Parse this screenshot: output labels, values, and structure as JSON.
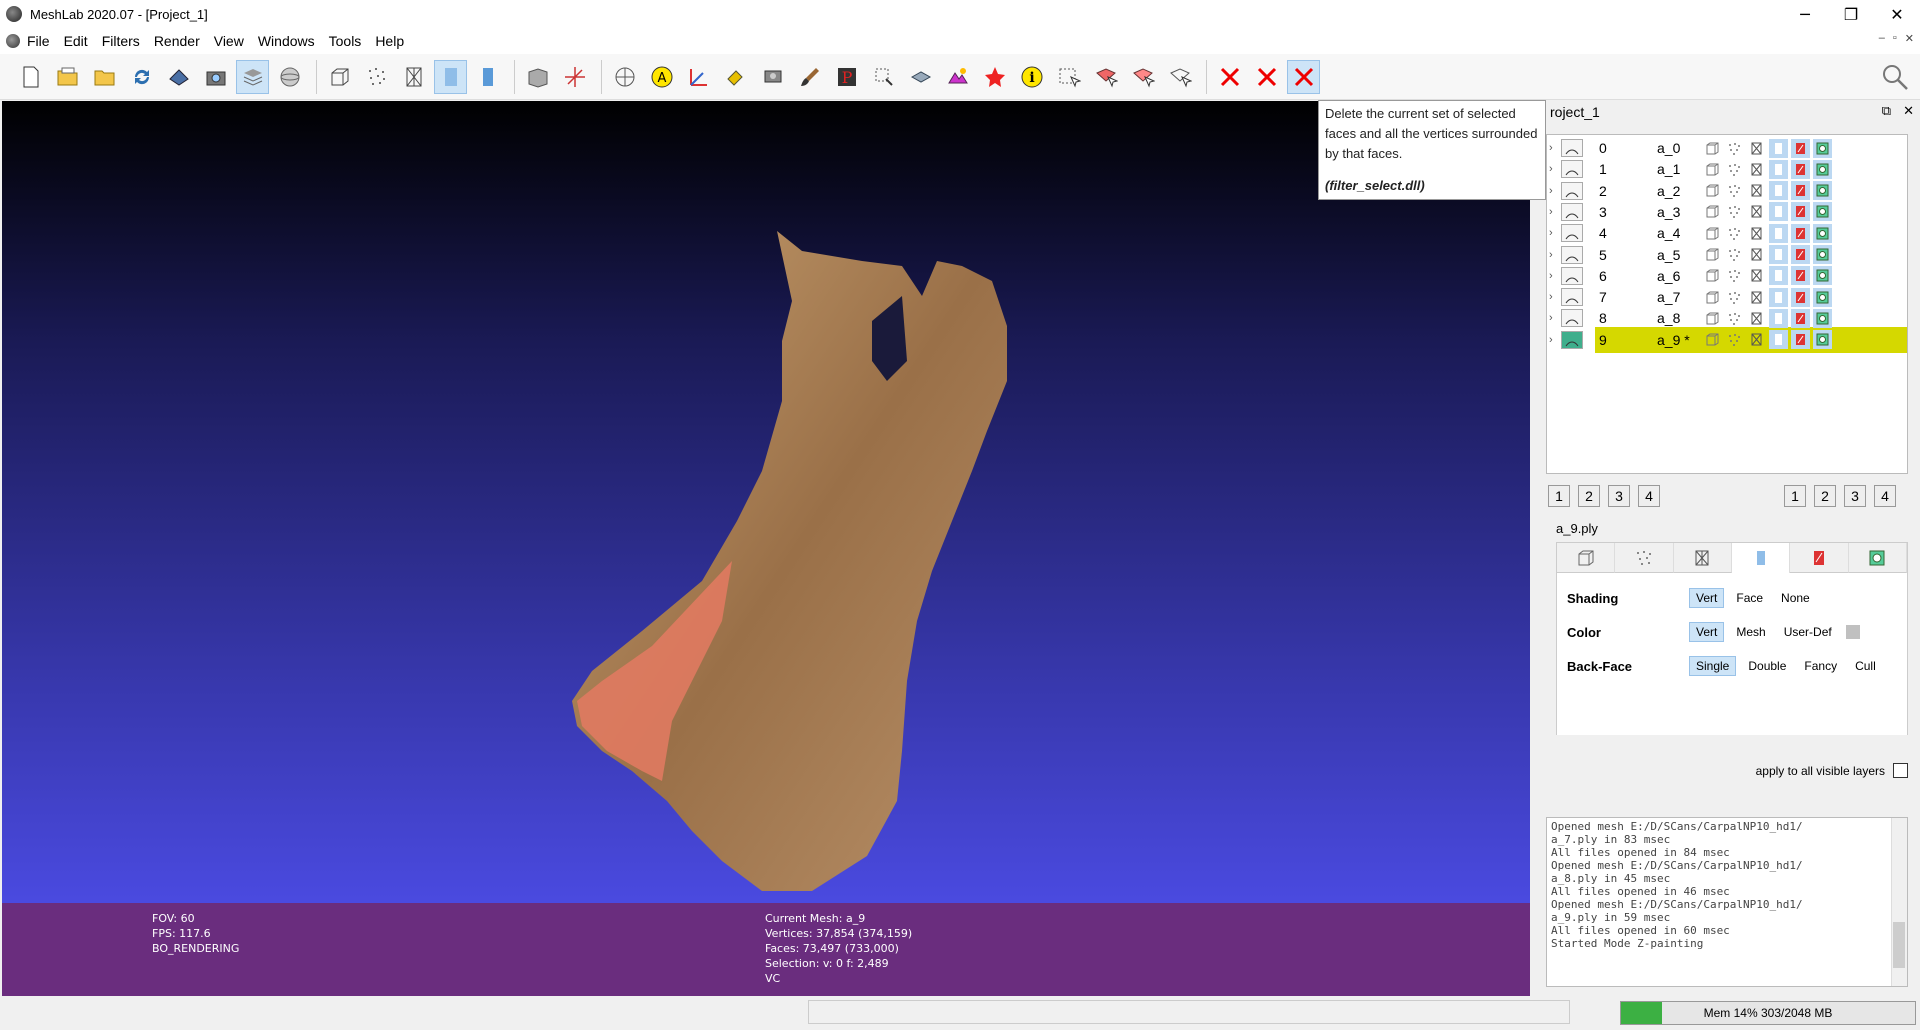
{
  "window": {
    "title": "MeshLab 2020.07 - [Project_1]"
  },
  "window_controls": {
    "minimize": "─",
    "maximize": "❐",
    "close": "✕"
  },
  "menu": [
    "File",
    "Edit",
    "Filters",
    "Render",
    "View",
    "Windows",
    "Tools",
    "Help"
  ],
  "mdi_controls": {
    "minimize": "–",
    "restore": "▫",
    "close": "✕"
  },
  "tooltip": {
    "text": "Delete the current set of selected faces and all the vertices surrounded by that faces.",
    "dll": "(filter_select.dll)"
  },
  "viewport_info": {
    "fov": "FOV: 60",
    "fps": "FPS:   117.6",
    "rendering": "BO_RENDERING",
    "current_mesh": "Current Mesh: a_9",
    "vertices": "Vertices: 37,854    (374,159)",
    "faces": "Faces: 73,497    (733,000)",
    "selection": "Selection: v: 0 f: 2,489",
    "vc": "VC"
  },
  "layer_dialog": {
    "title": "roject_1",
    "float_icon": "⧉",
    "close_icon": "✕",
    "layers": [
      {
        "index": "0",
        "name": "a_0"
      },
      {
        "index": "1",
        "name": "a_1"
      },
      {
        "index": "2",
        "name": "a_2"
      },
      {
        "index": "3",
        "name": "a_3"
      },
      {
        "index": "4",
        "name": "a_4"
      },
      {
        "index": "5",
        "name": "a_5"
      },
      {
        "index": "6",
        "name": "a_6"
      },
      {
        "index": "7",
        "name": "a_7"
      },
      {
        "index": "8",
        "name": "a_8"
      },
      {
        "index": "9",
        "name": "a_9 *"
      }
    ],
    "selected_layer": 9,
    "view_buttons_left": [
      "1",
      "2",
      "3",
      "4"
    ],
    "view_buttons_right": [
      "1",
      "2",
      "3",
      "4"
    ],
    "mesh_file": "a_9.ply",
    "shading": {
      "label": "Shading",
      "options": [
        "Vert",
        "Face",
        "None"
      ],
      "selected": "Vert"
    },
    "color": {
      "label": "Color",
      "options": [
        "Vert",
        "Mesh",
        "User-Def"
      ],
      "selected": "Vert"
    },
    "backface": {
      "label": "Back-Face",
      "options": [
        "Single",
        "Double",
        "Fancy",
        "Cull"
      ],
      "selected": "Single"
    },
    "apply_all_label": "apply to all visible layers",
    "log": [
      "Opened mesh E:/D/SCans/CarpalNP10_hd1/",
      "a_7.ply in 83 msec",
      "All files opened in 84 msec",
      "Opened mesh E:/D/SCans/CarpalNP10_hd1/",
      "a_8.ply in 45 msec",
      "All files opened in 46 msec",
      "Opened mesh E:/D/SCans/CarpalNP10_hd1/",
      "a_9.ply in 59 msec",
      "All files opened in 60 msec",
      "Started Mode Z-painting"
    ]
  },
  "status": {
    "memory": "Mem 14% 303/2048 MB",
    "memory_fraction": 0.14
  },
  "colors": {
    "selection_highlight": "#d5d800",
    "info_bar": "#6a2d7e",
    "mem_fill": "#3cb043"
  }
}
